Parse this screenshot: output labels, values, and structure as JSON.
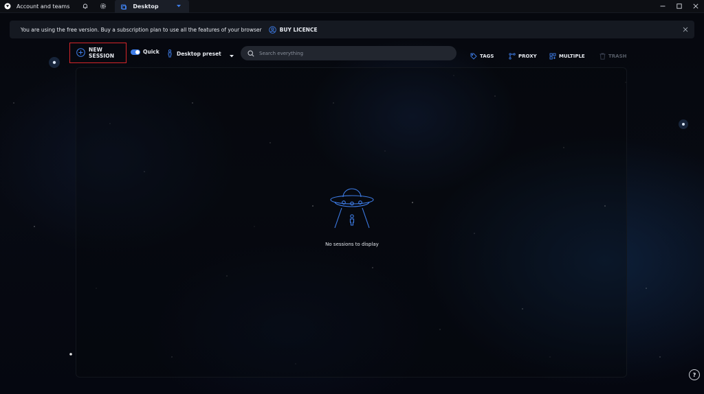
{
  "titlebar": {
    "account_label": "Account and teams",
    "tab_label": "Desktop",
    "icons": [
      "app-logo-icon",
      "bell-icon",
      "gear-icon",
      "desktop-icon",
      "chevron-down-icon",
      "minimize-icon",
      "maximize-icon",
      "close-icon"
    ]
  },
  "banner": {
    "text": "You are using the free version. Buy a subscription plan to use all the features of your browser",
    "buy_label": "BUY LICENCE"
  },
  "toolbar": {
    "new_session_label": "NEW SESSION",
    "quick_label": "Quick",
    "quick_enabled": true,
    "preset_label": "Desktop preset",
    "search_placeholder": "Search everything",
    "tags_label": "TAGS",
    "proxy_label": "PROXY",
    "multiple_label": "MULTIPLE",
    "trash_label": "TRASH"
  },
  "main": {
    "empty_message": "No sessions to display"
  },
  "help_label": "?",
  "colors": {
    "accent": "#3e7de8",
    "highlight": "#d8262a",
    "panel": "#161a22"
  }
}
